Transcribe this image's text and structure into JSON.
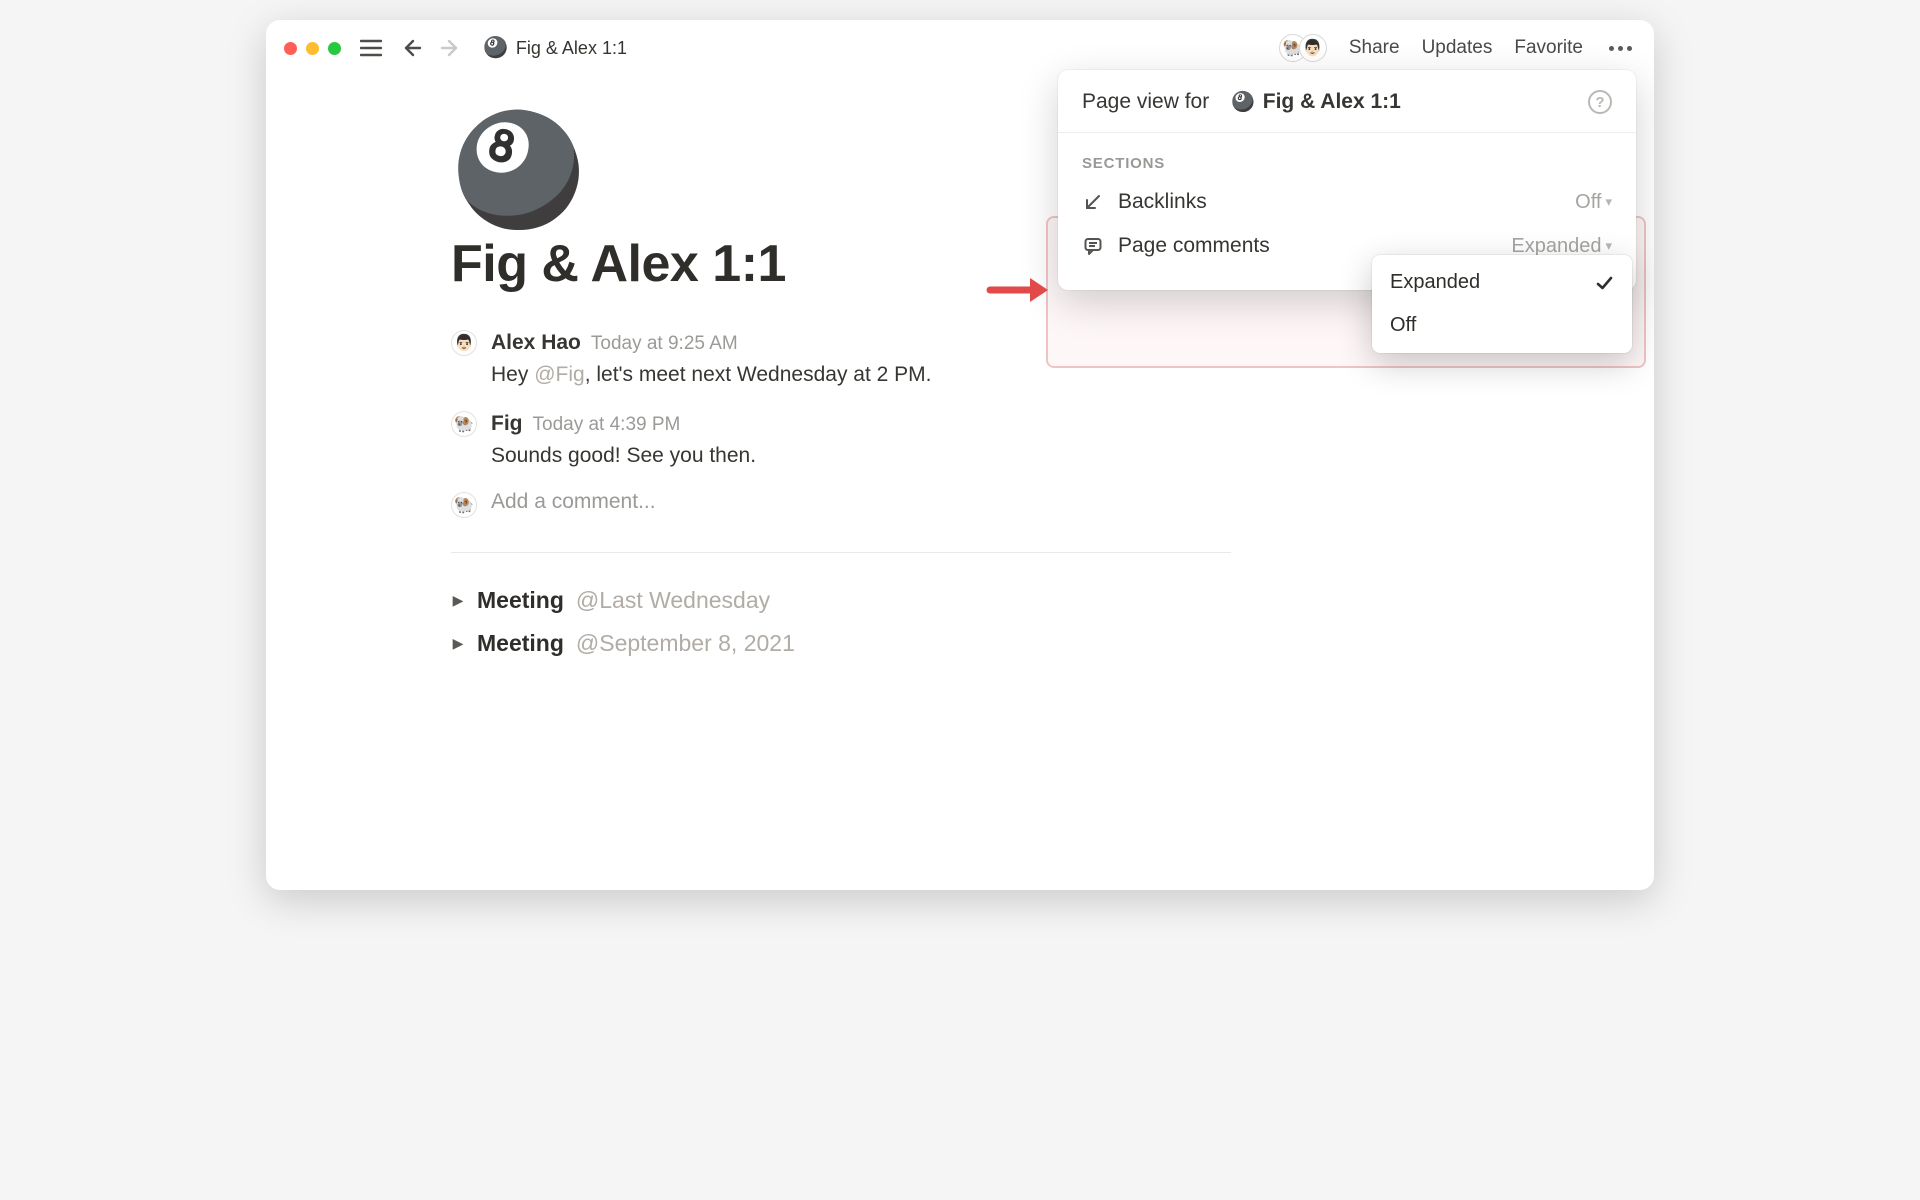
{
  "header": {
    "breadcrumb_icon": "🎱",
    "breadcrumb_title": "Fig & Alex 1:1",
    "share": "Share",
    "updates": "Updates",
    "favorite": "Favorite"
  },
  "page": {
    "icon": "🎱",
    "title": "Fig & Alex 1:1"
  },
  "comments": [
    {
      "avatar": "👨🏻",
      "author": "Alex Hao",
      "time": "Today at 9:25 AM",
      "body_pre": "Hey ",
      "mention": "@Fig",
      "body_post": ", let's meet next Wednesday at 2 PM."
    },
    {
      "avatar": "🐏",
      "author": "Fig",
      "time": "Today at 4:39 PM",
      "body_pre": "Sounds good! See you then.",
      "mention": "",
      "body_post": ""
    }
  ],
  "comment_input": {
    "avatar": "🐏",
    "placeholder": "Add a comment..."
  },
  "meetings": [
    {
      "title": "Meeting",
      "date": "@Last Wednesday"
    },
    {
      "title": "Meeting",
      "date": "@September 8, 2021"
    }
  ],
  "popover": {
    "title_prefix": "Page view for",
    "title_icon": "🎱",
    "title_page": "Fig & Alex 1:1",
    "sections_label": "SECTIONS",
    "rows": {
      "backlinks": {
        "label": "Backlinks",
        "value": "Off"
      },
      "page_comments": {
        "label": "Page comments",
        "value": "Expanded"
      }
    },
    "dropdown": {
      "options": [
        "Expanded",
        "Off"
      ],
      "selected": "Expanded"
    }
  }
}
